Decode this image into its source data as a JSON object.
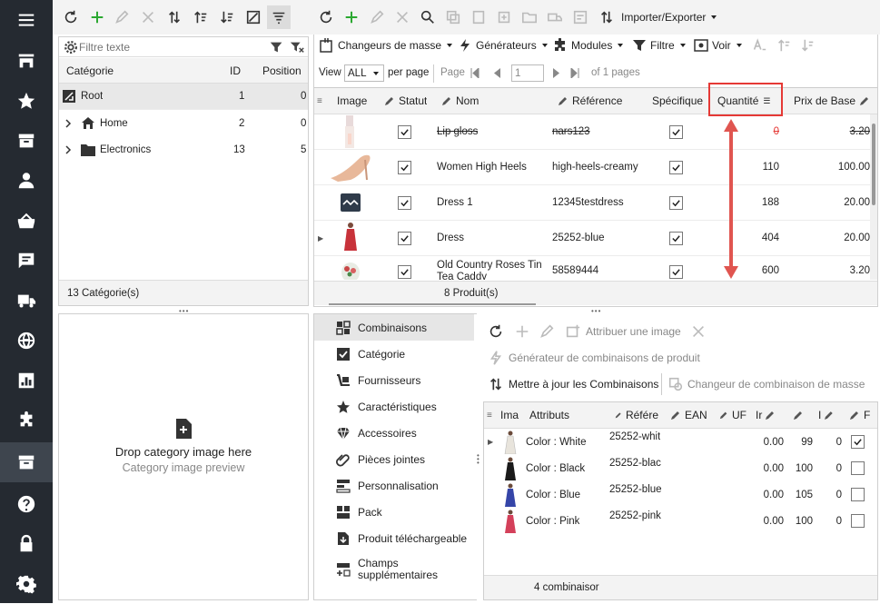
{
  "nav": {
    "menu_icon": "hamburger-icon",
    "items": [
      "store-icon",
      "star-icon",
      "box-icon",
      "user-icon",
      "basket-icon",
      "message-icon",
      "truck-icon",
      "globe-icon",
      "chart-icon",
      "puzzle-icon",
      "archive-icon",
      "help-icon",
      "lock-icon",
      "gear-icon"
    ]
  },
  "category_panel": {
    "filter_placeholder": "Filtre texte",
    "columns": [
      "Catégorie",
      "ID",
      "Position"
    ],
    "rows": [
      {
        "name": "Root",
        "id": "1",
        "position": "0"
      },
      {
        "name": "Home",
        "id": "2",
        "position": "0"
      },
      {
        "name": "Electronics",
        "id": "13",
        "position": "5"
      }
    ],
    "footer": "13 Catégorie(s)"
  },
  "category_image": {
    "title": "Drop category image here",
    "subtitle": "Category image preview"
  },
  "product_panel": {
    "import_export": "Importer/Exporter",
    "menus": [
      "Changeurs de masse",
      "Générateurs",
      "Modules",
      "Filtre",
      "Voir"
    ],
    "view_label": "View",
    "view_value": "ALL",
    "per_page": "per page",
    "page_label": "Page",
    "page_value": "1",
    "of_pages": "of 1 pages",
    "columns": [
      "Image",
      "Statut",
      "Nom",
      "Référence",
      "Spécifique",
      "Quantité",
      "Prix de Base"
    ],
    "rows": [
      {
        "name": "Lip gloss",
        "reference": "nars123",
        "quantity": "0",
        "price": "3.20"
      },
      {
        "name": "Women High Heels",
        "reference": "high-heels-creamy",
        "quantity": "110",
        "price": "100.00"
      },
      {
        "name": "Dress 1",
        "reference": "12345testdress",
        "quantity": "188",
        "price": "20.00"
      },
      {
        "name": "Dress",
        "reference": "25252-blue",
        "quantity": "404",
        "price": "20.00"
      },
      {
        "name": "Old Country Roses Tin Tea Caddy",
        "reference": "58589444",
        "quantity": "600",
        "price": "3.20"
      }
    ],
    "footer": "8 Produit(s)",
    "highlight_color": "#e53935"
  },
  "detail_tabs": {
    "items": [
      "Combinaisons",
      "Catégorie",
      "Fournisseurs",
      "Caractéristiques",
      "Accessoires",
      "Pièces jointes",
      "Personnalisation",
      "Pack",
      "Produit téléchargeable",
      "Champs supplémentaires"
    ]
  },
  "combinations": {
    "assign_image": "Attribuer une image",
    "generator": "Générateur de combinaisons de produit",
    "update": "Mettre à jour les Combinaisons",
    "mass_changer": "Changeur de combinaison de masse",
    "columns": [
      "Ima",
      "Attributs",
      "Référe",
      "EAN",
      "UF",
      "Ir",
      "",
      "I",
      "F"
    ],
    "rows": [
      {
        "attr": "Color : White",
        "ref": "25252-whit",
        "v1": "0.00",
        "v2": "99",
        "v3": "0",
        "checked": true,
        "color": "#e8e4dc"
      },
      {
        "attr": "Color : Black",
        "ref": "25252-blac",
        "v1": "0.00",
        "v2": "100",
        "v3": "0",
        "checked": false,
        "color": "#1a1a1a"
      },
      {
        "attr": "Color : Blue",
        "ref": "25252-blue",
        "v1": "0.00",
        "v2": "105",
        "v3": "0",
        "checked": false,
        "color": "#3545a8"
      },
      {
        "attr": "Color : Pink",
        "ref": "25252-pink",
        "v1": "0.00",
        "v2": "100",
        "v3": "0",
        "checked": false,
        "color": "#d4405a"
      }
    ],
    "footer": "4 combinaisor"
  }
}
